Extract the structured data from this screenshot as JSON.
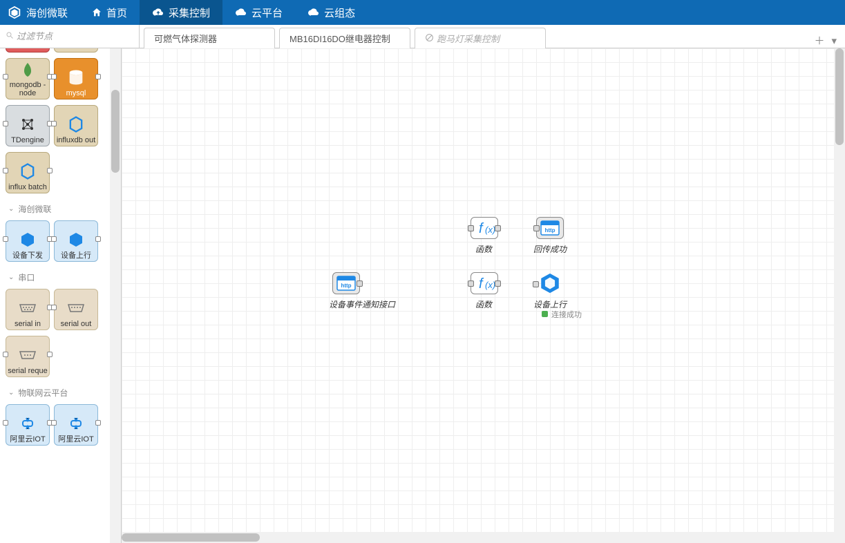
{
  "brand": {
    "title": "海创微联"
  },
  "nav": {
    "home": "首页",
    "collect": "采集控制",
    "cloud": "云平台",
    "cloudcfg": "云组态"
  },
  "filter": {
    "placeholder": "过滤节点",
    "value": ""
  },
  "tabs": {
    "t1": "可燃气体探测器",
    "t2": "MB16DI16DO继电器控制",
    "t3": "跑马灯采集控制"
  },
  "palette": {
    "redNode": "",
    "influxIn": "",
    "mongodb": "mongodb - node",
    "mysql": "mysql",
    "tdengine": "TDengine",
    "influxOut": "influxdb out",
    "influxBatch": "influx batch",
    "cat1": "海创微联",
    "devDown": "设备下发",
    "devUp": "设备上行",
    "cat2": "串口",
    "serialIn": "serial in",
    "serialOut": "serial out",
    "serialReq": "serial reque",
    "cat3": "物联网云平台",
    "aliIot1": "阿里云IOT",
    "aliIot2": "阿里云IOT"
  },
  "flow": {
    "httpIn": "设备事件通知接口",
    "func1": "函数",
    "func2": "函数",
    "httpOut": "回传成功",
    "devUp": "设备上行",
    "statusText": "连接成功"
  }
}
